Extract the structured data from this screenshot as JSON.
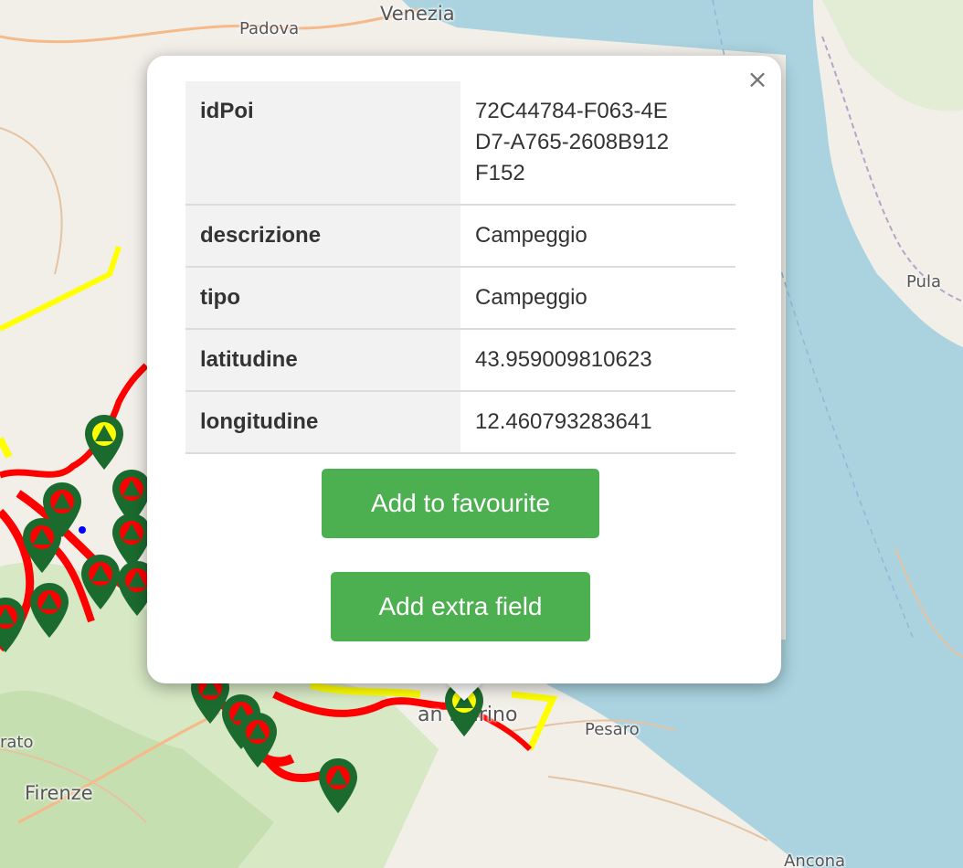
{
  "map": {
    "places": {
      "venezia": "Venezia",
      "padova": "Padova",
      "pula": "Pula",
      "pesaro": "Pesaro",
      "firenze": "Firenze",
      "prato": "rato",
      "sanmarino": "an Marino",
      "ancona": "Ancona"
    },
    "colors": {
      "sea": "#aad3df",
      "land": "#f2efe9",
      "forest": "#c8e0b0",
      "route_red": "#ff0000",
      "route_yellow": "#ffff00",
      "marker": "#1b6b2f"
    },
    "marker_icon": "campsite-icon"
  },
  "popup": {
    "close_label": "×",
    "rows": [
      {
        "key": "idPoi",
        "value": "72C44784-F063-4ED7-A765-2608B912F152"
      },
      {
        "key": "descrizione",
        "value": "Campeggio"
      },
      {
        "key": "tipo",
        "value": "Campeggio"
      },
      {
        "key": "latitudine",
        "value": "43.959009810623"
      },
      {
        "key": "longitudine",
        "value": "12.460793283641"
      }
    ],
    "add_favourite_label": "Add to favourite",
    "add_extra_label": "Add extra field",
    "button_color": "#4caf50"
  }
}
